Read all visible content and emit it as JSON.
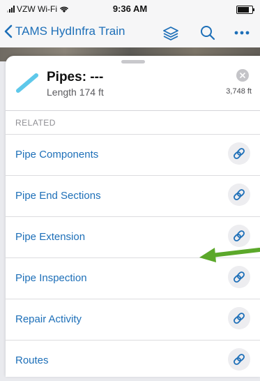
{
  "status_bar": {
    "carrier": "VZW Wi-Fi",
    "time": "9:36 AM",
    "battery_level": 0.9
  },
  "nav": {
    "back_label": "TAMS HydInfra Train",
    "icons": [
      "chevron-left-icon",
      "layers-icon",
      "search-icon",
      "more-icon"
    ]
  },
  "feature": {
    "title": "Pipes: ---",
    "subtitle": "Length 174 ft",
    "distance": "3,748 ft",
    "icon": "pipe-line-icon",
    "accent_color": "#5ec8ea"
  },
  "related": {
    "section_label": "RELATED",
    "items": [
      {
        "label": "Pipe Components"
      },
      {
        "label": "Pipe End Sections"
      },
      {
        "label": "Pipe Extension"
      },
      {
        "label": "Pipe Inspection"
      },
      {
        "label": "Repair Activity"
      },
      {
        "label": "Routes"
      }
    ],
    "link_color": "#1d6fb8"
  },
  "annotation": {
    "arrow_color": "#5ba82a",
    "points_to": "Pipe Inspection"
  }
}
